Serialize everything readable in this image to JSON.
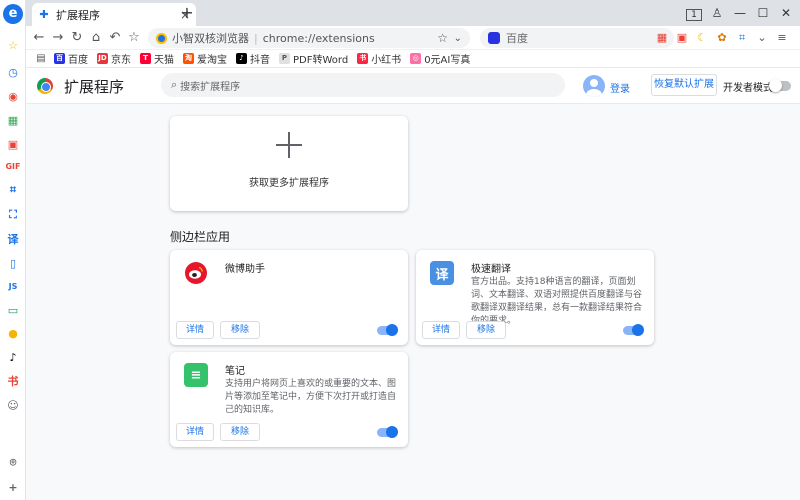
{
  "sidebar": {
    "logo": "e",
    "icons": [
      {
        "name": "star-icon",
        "glyph": "☆",
        "color": "#f4b400"
      },
      {
        "name": "history-clock-icon",
        "glyph": "◷",
        "color": "#1a73e8"
      },
      {
        "name": "record-icon",
        "glyph": "◉",
        "color": "#ea4335"
      },
      {
        "name": "qr-grid-icon",
        "glyph": "▦",
        "color": "#34a853"
      },
      {
        "name": "pdf-icon",
        "glyph": "▣",
        "color": "#ea4335"
      },
      {
        "name": "gif-icon",
        "glyph": "GIF",
        "color": "#ea4335"
      },
      {
        "name": "crop-icon",
        "glyph": "⌗",
        "color": "#1a73e8"
      },
      {
        "name": "scan-text-icon",
        "glyph": "⛶",
        "color": "#1a73e8"
      },
      {
        "name": "translate-icon",
        "glyph": "译",
        "color": "#1a73e8"
      },
      {
        "name": "phone-icon",
        "glyph": "▯",
        "color": "#1a73e8"
      },
      {
        "name": "js-icon",
        "glyph": "JS",
        "color": "#1a73e8"
      },
      {
        "name": "screen-icon",
        "glyph": "▭",
        "color": "#0f9d58"
      },
      {
        "name": "app-avatar-icon",
        "glyph": "●",
        "color": "#f4b400"
      },
      {
        "name": "tiktok-icon",
        "glyph": "♪",
        "color": "#000000"
      },
      {
        "name": "xiaohongshu-icon",
        "glyph": "书",
        "color": "#ea4335"
      },
      {
        "name": "user-avatar-icon",
        "glyph": "☺",
        "color": "#5f6368"
      },
      {
        "name": "lightbulb-icon",
        "glyph": "⌾",
        "color": "#5f6368"
      },
      {
        "name": "add-icon",
        "glyph": "+",
        "color": "#5f6368"
      }
    ]
  },
  "tab": {
    "title": "扩展程序",
    "close": "×",
    "new_tab": "+"
  },
  "window": {
    "tab_count": "1",
    "tshirt": "♙",
    "minimize": "—",
    "maximize": "☐",
    "close": "✕"
  },
  "toolbar": {
    "back": "←",
    "forward": "→",
    "reload": "↻",
    "home": "⌂",
    "undo": "↶",
    "bookmark": "☆"
  },
  "omnibox": {
    "brand": "小智双核浏览器",
    "separator": "|",
    "url": "chrome://extensions",
    "star": "☆",
    "dropdown": "⌄"
  },
  "search": {
    "placeholder": "百度",
    "icon": "⌕"
  },
  "extensions_bar": {
    "icons": [
      "▦",
      "▣",
      "☾",
      "✿",
      "⌗",
      "⌄",
      "≡"
    ]
  },
  "bookmarks": [
    {
      "label": "百度",
      "color": "#2932e1",
      "glyph": "百"
    },
    {
      "label": "京东",
      "color": "#e4393c",
      "glyph": "JD"
    },
    {
      "label": "天猫",
      "color": "#ff0036",
      "glyph": "T"
    },
    {
      "label": "爱淘宝",
      "color": "#ff5000",
      "glyph": "淘"
    },
    {
      "label": "抖音",
      "color": "#000000",
      "glyph": "♪"
    },
    {
      "label": "PDF转Word",
      "color": "#e0e0e0",
      "glyph": "P"
    },
    {
      "label": "小红书",
      "color": "#ff2442",
      "glyph": "书"
    },
    {
      "label": "0元AI写真",
      "color": "#ff6fa6",
      "glyph": "◎"
    }
  ],
  "page": {
    "title": "扩展程序",
    "search_placeholder": "搜索扩展程序",
    "login": "登录",
    "restore_default": "恢复默认扩展",
    "developer_mode": "开发者模式",
    "developer_mode_on": false,
    "get_more": "获取更多扩展程序",
    "section_title": "侧边栏应用",
    "cards": [
      {
        "name": "微博助手",
        "description": "",
        "icon_glyph": "◉",
        "icon_color": "#e6162d",
        "details": "详情",
        "remove": "移除",
        "enabled": true
      },
      {
        "name": "极速翻译",
        "description": "官方出品。支持18种语言的翻译，页面划词、文本翻译、双语对照提供百度翻译与谷歌翻译双翻译结果，总有一款翻译结果符合你的要求。",
        "icon_glyph": "译",
        "icon_color": "#4a90e2",
        "details": "详情",
        "remove": "移除",
        "enabled": true
      },
      {
        "name": "笔记",
        "description": "支持用户将网页上喜欢的或重要的文本、图片等添加至笔记中，方便下次打开或打造自己的知识库。",
        "icon_glyph": "≡",
        "icon_color": "#34c26a",
        "details": "详情",
        "remove": "移除",
        "enabled": true
      }
    ]
  }
}
